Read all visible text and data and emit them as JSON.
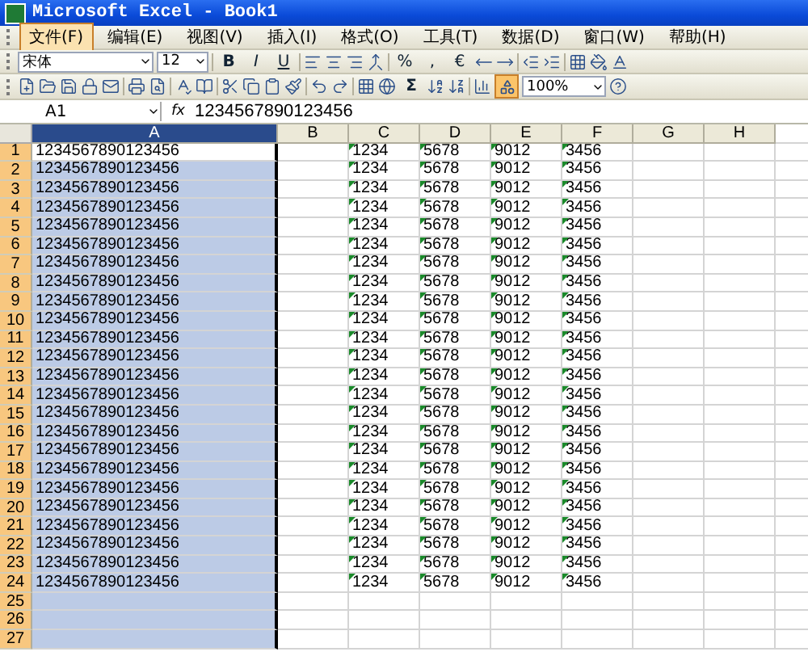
{
  "window": {
    "title": "Microsoft Excel - Book1"
  },
  "menu": [
    {
      "label": "文件(F)",
      "selected": true
    },
    {
      "label": "编辑(E)",
      "selected": false
    },
    {
      "label": "视图(V)",
      "selected": false
    },
    {
      "label": "插入(I)",
      "selected": false
    },
    {
      "label": "格式(O)",
      "selected": false
    },
    {
      "label": "工具(T)",
      "selected": false
    },
    {
      "label": "数据(D)",
      "selected": false
    },
    {
      "label": "窗口(W)",
      "selected": false
    },
    {
      "label": "帮助(H)",
      "selected": false
    }
  ],
  "formatting_toolbar": {
    "font": "宋体",
    "size": "12",
    "style_buttons": [
      "B",
      "I",
      "U"
    ],
    "number_buttons": [
      "%",
      ",",
      "€"
    ]
  },
  "standard_toolbar": {
    "autosum": "Σ",
    "drawing_pressed": true,
    "zoom": "100%"
  },
  "formula_bar": {
    "name_box": "A1",
    "fx": "fx",
    "value": "1234567890123456"
  },
  "sheet": {
    "columns": [
      {
        "label": "A",
        "selected": true,
        "flagged": false
      },
      {
        "label": "B",
        "selected": false,
        "flagged": false
      },
      {
        "label": "C",
        "selected": false,
        "flagged": true
      },
      {
        "label": "D",
        "selected": false,
        "flagged": true
      },
      {
        "label": "E",
        "selected": false,
        "flagged": true
      },
      {
        "label": "F",
        "selected": false,
        "flagged": true
      },
      {
        "label": "G",
        "selected": false,
        "flagged": false
      },
      {
        "label": "H",
        "selected": false,
        "flagged": false
      }
    ],
    "rows": [
      {
        "label": "1",
        "active": true,
        "cells": [
          "1234567890123456",
          "",
          "1234",
          "5678",
          "9012",
          "3456",
          "",
          ""
        ]
      },
      {
        "label": "2",
        "active": false,
        "cells": [
          "1234567890123456",
          "",
          "1234",
          "5678",
          "9012",
          "3456",
          "",
          ""
        ]
      },
      {
        "label": "3",
        "active": false,
        "cells": [
          "1234567890123456",
          "",
          "1234",
          "5678",
          "9012",
          "3456",
          "",
          ""
        ]
      },
      {
        "label": "4",
        "active": false,
        "cells": [
          "1234567890123456",
          "",
          "1234",
          "5678",
          "9012",
          "3456",
          "",
          ""
        ]
      },
      {
        "label": "5",
        "active": false,
        "cells": [
          "1234567890123456",
          "",
          "1234",
          "5678",
          "9012",
          "3456",
          "",
          ""
        ]
      },
      {
        "label": "6",
        "active": false,
        "cells": [
          "1234567890123456",
          "",
          "1234",
          "5678",
          "9012",
          "3456",
          "",
          ""
        ]
      },
      {
        "label": "7",
        "active": false,
        "cells": [
          "1234567890123456",
          "",
          "1234",
          "5678",
          "9012",
          "3456",
          "",
          ""
        ]
      },
      {
        "label": "8",
        "active": false,
        "cells": [
          "1234567890123456",
          "",
          "1234",
          "5678",
          "9012",
          "3456",
          "",
          ""
        ]
      },
      {
        "label": "9",
        "active": false,
        "cells": [
          "1234567890123456",
          "",
          "1234",
          "5678",
          "9012",
          "3456",
          "",
          ""
        ]
      },
      {
        "label": "10",
        "active": false,
        "cells": [
          "1234567890123456",
          "",
          "1234",
          "5678",
          "9012",
          "3456",
          "",
          ""
        ]
      },
      {
        "label": "11",
        "active": false,
        "cells": [
          "1234567890123456",
          "",
          "1234",
          "5678",
          "9012",
          "3456",
          "",
          ""
        ]
      },
      {
        "label": "12",
        "active": false,
        "cells": [
          "1234567890123456",
          "",
          "1234",
          "5678",
          "9012",
          "3456",
          "",
          ""
        ]
      },
      {
        "label": "13",
        "active": false,
        "cells": [
          "1234567890123456",
          "",
          "1234",
          "5678",
          "9012",
          "3456",
          "",
          ""
        ]
      },
      {
        "label": "14",
        "active": false,
        "cells": [
          "1234567890123456",
          "",
          "1234",
          "5678",
          "9012",
          "3456",
          "",
          ""
        ]
      },
      {
        "label": "15",
        "active": false,
        "cells": [
          "1234567890123456",
          "",
          "1234",
          "5678",
          "9012",
          "3456",
          "",
          ""
        ]
      },
      {
        "label": "16",
        "active": false,
        "cells": [
          "1234567890123456",
          "",
          "1234",
          "5678",
          "9012",
          "3456",
          "",
          ""
        ]
      },
      {
        "label": "17",
        "active": false,
        "cells": [
          "1234567890123456",
          "",
          "1234",
          "5678",
          "9012",
          "3456",
          "",
          ""
        ]
      },
      {
        "label": "18",
        "active": false,
        "cells": [
          "1234567890123456",
          "",
          "1234",
          "5678",
          "9012",
          "3456",
          "",
          ""
        ]
      },
      {
        "label": "19",
        "active": false,
        "cells": [
          "1234567890123456",
          "",
          "1234",
          "5678",
          "9012",
          "3456",
          "",
          ""
        ]
      },
      {
        "label": "20",
        "active": false,
        "cells": [
          "1234567890123456",
          "",
          "1234",
          "5678",
          "9012",
          "3456",
          "",
          ""
        ]
      },
      {
        "label": "21",
        "active": false,
        "cells": [
          "1234567890123456",
          "",
          "1234",
          "5678",
          "9012",
          "3456",
          "",
          ""
        ]
      },
      {
        "label": "22",
        "active": false,
        "cells": [
          "1234567890123456",
          "",
          "1234",
          "5678",
          "9012",
          "3456",
          "",
          ""
        ]
      },
      {
        "label": "23",
        "active": false,
        "cells": [
          "1234567890123456",
          "",
          "1234",
          "5678",
          "9012",
          "3456",
          "",
          ""
        ]
      },
      {
        "label": "24",
        "active": false,
        "cells": [
          "1234567890123456",
          "",
          "1234",
          "5678",
          "9012",
          "3456",
          "",
          ""
        ]
      },
      {
        "label": "25",
        "active": false,
        "cells": [
          "",
          "",
          "",
          "",
          "",
          "",
          "",
          ""
        ]
      },
      {
        "label": "26",
        "active": false,
        "cells": [
          "",
          "",
          "",
          "",
          "",
          "",
          "",
          ""
        ]
      },
      {
        "label": "27",
        "active": false,
        "cells": [
          "",
          "",
          "",
          "",
          "",
          "",
          "",
          ""
        ]
      }
    ]
  }
}
